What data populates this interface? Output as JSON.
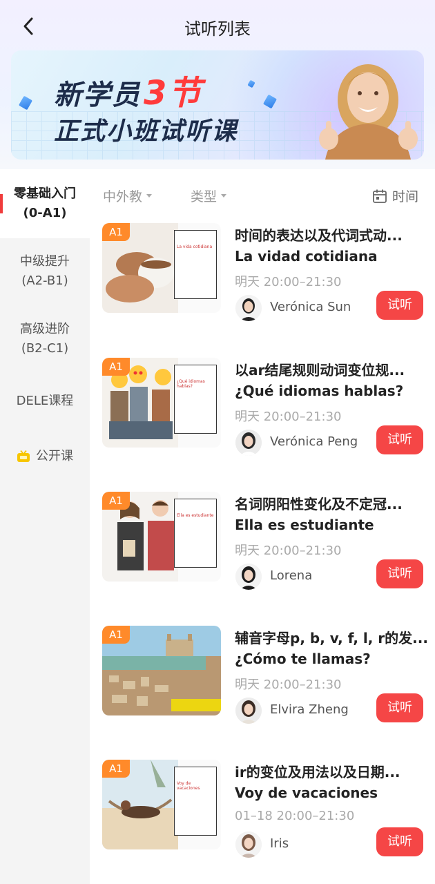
{
  "header": {
    "title": "试听列表"
  },
  "banner": {
    "line1_a": "新学员",
    "line1_hl": "3节",
    "line2": "正式小班试听课"
  },
  "sidebar": {
    "items": [
      {
        "label": "零基础入门\n(0-A1)",
        "l1": "零基础入门",
        "l2": "(0-A1)"
      },
      {
        "l1": "中级提升",
        "l2": "(A2-B1)"
      },
      {
        "l1": "高级进阶",
        "l2": "(B2-C1)"
      },
      {
        "l1": "DELE课程"
      },
      {
        "l1": "公开课"
      }
    ]
  },
  "filters": {
    "teacher": "中外教",
    "type": "类型",
    "time": "时间"
  },
  "courses": [
    {
      "badge": "A1",
      "title": "时间的表达以及代词式动...",
      "subtitle": "La vidad cotidiana",
      "time": "明天 20:00–21:30",
      "teacher": "Verónica Sun",
      "button": "试听",
      "doc_title": "La vida cotidiana"
    },
    {
      "badge": "A1",
      "title": "以ar结尾规则动词变位规...",
      "subtitle": "¿Qué idiomas hablas?",
      "time": "明天 20:00–21:30",
      "teacher": "Verónica Peng",
      "button": "试听",
      "doc_title": "¿Qué idiomas hablas?"
    },
    {
      "badge": "A1",
      "title": "名词阴阳性变化及不定冠...",
      "subtitle": "Ella es estudiante",
      "time": "明天 20:00–21:30",
      "teacher": "Lorena",
      "button": "试听",
      "doc_title": "Ella es estudiante"
    },
    {
      "badge": "A1",
      "title": "辅音字母p, b, v, f, l, r的发...",
      "subtitle": "¿Cómo te llamas?",
      "time": "明天 20:00–21:30",
      "teacher": "Elvira Zheng",
      "button": "试听",
      "doc_title": ""
    },
    {
      "badge": "A1",
      "title": "ir的变位及用法以及日期...",
      "subtitle": "Voy de vacaciones",
      "time": "01–18 20:00–21:30",
      "teacher": "Iris",
      "button": "试听",
      "doc_title": "Voy de vacaciones"
    }
  ],
  "colors": {
    "accent": "#f54646",
    "badge": "#ff8a2a"
  }
}
